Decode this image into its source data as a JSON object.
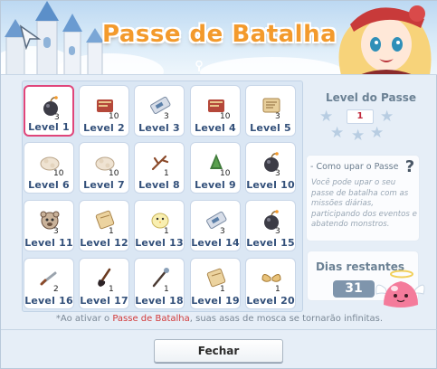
{
  "header": {
    "title": "Passe de Batalha"
  },
  "grid": {
    "items": [
      {
        "label": "Level 1",
        "qty": "3",
        "icon": "bomb-pouch-icon",
        "selected": true
      },
      {
        "label": "Level 2",
        "qty": "10",
        "icon": "book-icon"
      },
      {
        "label": "Level 3",
        "qty": "3",
        "icon": "ticket-icon"
      },
      {
        "label": "Level 4",
        "qty": "10",
        "icon": "book-icon"
      },
      {
        "label": "Level 5",
        "qty": "3",
        "icon": "scroll-map-icon"
      },
      {
        "label": "Level 6",
        "qty": "10",
        "icon": "cloth-bundle-icon"
      },
      {
        "label": "Level 7",
        "qty": "10",
        "icon": "cloth-bundle-icon"
      },
      {
        "label": "Level 8",
        "qty": "1",
        "icon": "branch-icon"
      },
      {
        "label": "Level 9",
        "qty": "10",
        "icon": "herb-icon"
      },
      {
        "label": "Level 10",
        "qty": "3",
        "icon": "bomb-pouch-icon"
      },
      {
        "label": "Level 11",
        "qty": "3",
        "icon": "bear-mask-icon"
      },
      {
        "label": "Level 12",
        "qty": "1",
        "icon": "scroll-icon"
      },
      {
        "label": "Level 13",
        "qty": "1",
        "icon": "chick-hat-icon"
      },
      {
        "label": "Level 14",
        "qty": "3",
        "icon": "ticket-icon"
      },
      {
        "label": "Level 15",
        "qty": "3",
        "icon": "bomb-pouch-icon"
      },
      {
        "label": "Level 16",
        "qty": "2",
        "icon": "dagger-icon"
      },
      {
        "label": "Level 17",
        "qty": "1",
        "icon": "broom-icon"
      },
      {
        "label": "Level 18",
        "qty": "1",
        "icon": "staff-icon"
      },
      {
        "label": "Level 19",
        "qty": "1",
        "icon": "scroll-icon"
      },
      {
        "label": "Level 20",
        "qty": "1",
        "icon": "wings-icon"
      }
    ]
  },
  "side": {
    "level_title": "Level do Passe",
    "current_level": "1",
    "help_title": "- Como upar o Passe",
    "help_text": "Você pode upar o seu passe de batalha com as missões diárias, participando dos eventos e abatendo monstros.",
    "days_label": "Dias restantes",
    "days_value": "31"
  },
  "note": {
    "prefix": "*Ao ativar o ",
    "highlight": "Passe de Batalha",
    "suffix": ", suas asas de mosca se tornarão infinitas."
  },
  "footer": {
    "close_label": "Fechar"
  },
  "colors": {
    "title_orange": "#f39a2c",
    "selected_border": "#e0457a",
    "level_text": "#33507a",
    "highlight_red": "#d23a3a"
  }
}
